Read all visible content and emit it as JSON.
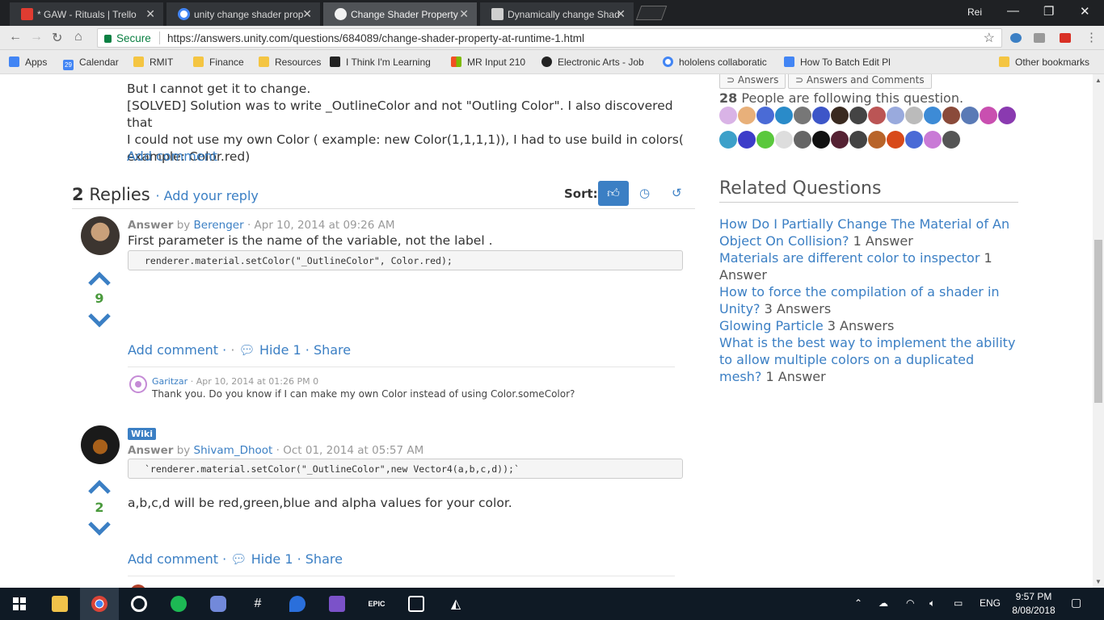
{
  "browser": {
    "tabs": [
      {
        "title": "* GAW - Rituals | Trello",
        "color": "#e03c31"
      },
      {
        "title": "unity change shader prop",
        "color": "#ffffff"
      },
      {
        "title": "Change Shader Property",
        "color": "#222222"
      },
      {
        "title": "Dynamically change Shad",
        "color": "#cfcfcf"
      }
    ],
    "close_glyph": "✕",
    "profile": "Rei",
    "secure_label": "Secure",
    "url": "https://answers.unity.com/questions/684089/change-shader-property-at-runtime-1.html",
    "bookmarks": [
      {
        "label": "Apps",
        "icon": "apps-icon"
      },
      {
        "label": "Calendar",
        "icon": "calendar-icon"
      },
      {
        "label": "RMIT",
        "icon": "folder-icon"
      },
      {
        "label": "Finance",
        "icon": "folder-icon"
      },
      {
        "label": "Resources",
        "icon": "folder-icon"
      },
      {
        "label": "I Think I'm Learning",
        "icon": "site-icon"
      },
      {
        "label": "MR Input 210",
        "icon": "microsoft-icon"
      },
      {
        "label": "Electronic Arts - Job",
        "icon": "ea-icon"
      },
      {
        "label": "hololens collaboratic",
        "icon": "google-icon"
      },
      {
        "label": "How To Batch Edit Pl",
        "icon": "plus-icon"
      },
      {
        "label": "Other bookmarks",
        "icon": "folder-icon"
      }
    ],
    "calendar_day": "29"
  },
  "question": {
    "lines": [
      "But I cannot get it to change.",
      "[SOLVED] Solution was to write _OutlineColor and not \"Outling Color\". I also discovered that",
      "I could not use my own Color ( example: new Color(1,1,1,1)), I had to use build in colors(",
      "example: Color.red)"
    ],
    "add_comment": "Add comment"
  },
  "replies": {
    "count": "2",
    "label": "Replies",
    "add_reply": "· Add your reply",
    "sort_label": "Sort:"
  },
  "answers": [
    {
      "label": "Answer",
      "by": "by",
      "user": "Berenger",
      "date": "· Apr 10, 2014 at 09:26 AM",
      "body": "First parameter is the name of the variable, not the label .",
      "code": "renderer.material.setColor(\"_OutlineColor\", Color.red);",
      "votes": "9",
      "add_comment": "Add comment ·",
      "dot": "·",
      "hide": "Hide 1",
      "share": "· Share",
      "comment": {
        "user": "Garitzar",
        "date": "· Apr 10, 2014 at 01:26 PM 0",
        "body": "Thank you. Do you know if I can make my own Color instead of using Color.someColor?"
      }
    },
    {
      "badge": "Wiki",
      "label": "Answer",
      "by": "by",
      "user": "Shivam_Dhoot",
      "date": "· Oct 01, 2014 at 05:57 AM",
      "code": "`renderer.material.setColor(\"_OutlineColor\",new Vector4(a,b,c,d));`",
      "body": "a,b,c,d will be red,green,blue and alpha values for your color.",
      "votes": "2",
      "add_comment": "Add comment ·",
      "hide": "Hide 1",
      "share": "· Share"
    }
  ],
  "sidebar": {
    "answers_btn": "Answers",
    "answers_comments_btn": "Answers and Comments",
    "following_count": "28",
    "following_text": "People are following this question.",
    "related_title": "Related Questions",
    "related": [
      {
        "q": "How Do I Partially Change The Material of An Object On Collision?",
        "a": "1 Answer"
      },
      {
        "q": "Materials are different color to inspector",
        "a": "1 Answer"
      },
      {
        "q": "How to force the compilation of a shader in Unity?",
        "a": "3 Answers"
      },
      {
        "q": "Glowing Particle",
        "a": "3 Answers"
      },
      {
        "q": "What is the best way to implement the ability to allow multiple colors on a duplicated mesh?",
        "a": "1 Answer"
      }
    ]
  },
  "taskbar": {
    "epic": "EPIC",
    "lang": "ENG",
    "time": "9:57 PM",
    "date": "8/08/2018"
  },
  "colors": {
    "link": "#3b7fc4",
    "vote_green": "#4a9a3d"
  }
}
